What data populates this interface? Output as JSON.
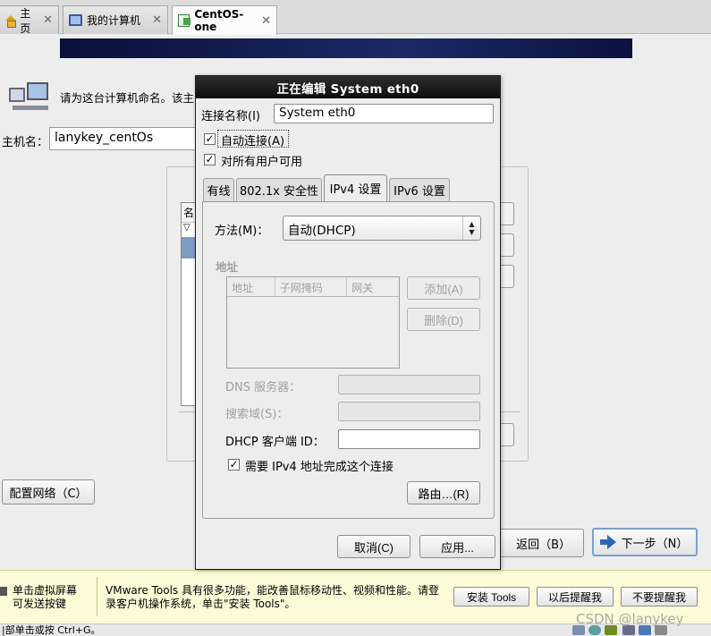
{
  "tabs": [
    {
      "label": "主页",
      "icon": "home-icon"
    },
    {
      "label": "我的计算机",
      "icon": "computer-icon"
    },
    {
      "label": "CentOS-one",
      "icon": "vm-icon"
    }
  ],
  "installer": {
    "prompt": "请为这台计算机命名。该主机名",
    "hostname_label": "主机名：",
    "hostname_value": "lanykey_centOs",
    "list_header": "名",
    "list_row": "▽",
    "config_network_button": "配置网络（C）",
    "back_button": "返回（B）",
    "next_button": "下一步（N）"
  },
  "dialog": {
    "title": "正在编辑 System eth0",
    "conn_name_label": "连接名称(I)",
    "conn_name_value": "System eth0",
    "auto_connect_label": "自动连接(A)",
    "auto_connect_checked": "✓",
    "all_users_label": "对所有用户可用",
    "all_users_checked": "✓",
    "tabs": [
      "有线",
      "802.1x 安全性",
      "IPv4 设置",
      "IPv6 设置"
    ],
    "active_tab": "IPv4 设置",
    "method_label": "方法(M)：",
    "method_value": "自动(DHCP)",
    "address_section": "地址",
    "address_columns": [
      "地址",
      "子网掩码",
      "网关"
    ],
    "add_button": "添加(A)",
    "delete_button": "删除(D)",
    "dns_label": "DNS 服务器：",
    "search_domain_label": "搜索域(S)：",
    "dhcp_client_id_label": "DHCP 客户端 ID：",
    "require_ipv4_label": "需要 IPv4 地址完成这个连接",
    "require_ipv4_checked": "✓",
    "routes_button": "路由…(R)",
    "cancel_button": "取消(C)",
    "apply_button": "应用..."
  },
  "toolsbar": {
    "left_line1": "单击虚拟屏幕",
    "left_line2": "可发送按键",
    "message": "VMware Tools 具有很多功能，能改善鼠标移动性、视频和性能。请登录客户机操作系统，单击\"安装 Tools\"。",
    "install_button": "安装 Tools",
    "remind_later_button": "以后提醒我",
    "never_remind_button": "不要提醒我"
  },
  "statusbar": {
    "text": "|部单击或按 Ctrl+G。"
  },
  "watermark": "CSDN @lanykey"
}
